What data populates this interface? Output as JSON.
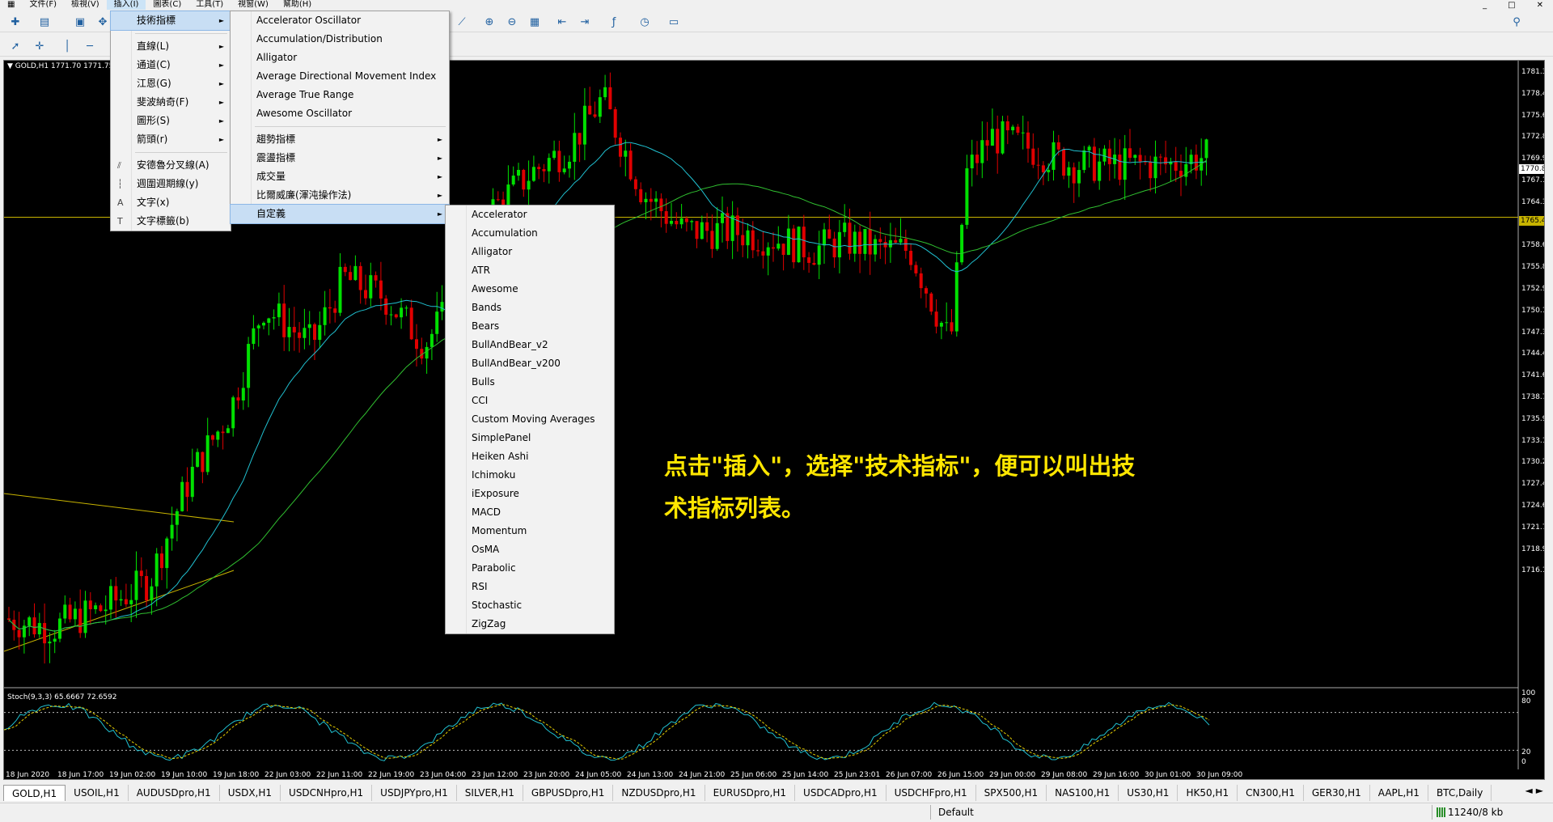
{
  "menubar": {
    "items": [
      "文件(F)",
      "檢視(V)",
      "插入(I)",
      "圖表(C)",
      "工具(T)",
      "視窗(W)",
      "幫助(H)"
    ],
    "active_index": 2,
    "win_buttons": [
      "_",
      "□",
      "✕"
    ]
  },
  "chart": {
    "symbol_label": "▼ GOLD,H1  1771.70 1771.75",
    "stoch_label": "Stoch(9,3,3) 65.6667 72.6592",
    "bid_price": "1770.83",
    "hline_price": "1765.43",
    "price_axis": [
      "1781.30",
      "1778.45",
      "1775.60",
      "1772.80",
      "1769.95",
      "1767.10",
      "1764.30",
      "1761.45",
      "1758.60",
      "1755.80",
      "1752.95",
      "1750.10",
      "1747.30",
      "1744.45",
      "1741.60",
      "1738.75",
      "1735.95",
      "1733.10",
      "1730.25",
      "1727.45",
      "1724.60",
      "1721.75",
      "1718.95",
      "1716.10"
    ],
    "stoch_axis": [
      "100",
      "80",
      "20",
      "0"
    ],
    "time_axis": [
      "18 Jun 2020",
      "18 Jun 17:00",
      "19 Jun 02:00",
      "19 Jun 10:00",
      "19 Jun 18:00",
      "22 Jun 03:00",
      "22 Jun 11:00",
      "22 Jun 19:00",
      "23 Jun 04:00",
      "23 Jun 12:00",
      "23 Jun 20:00",
      "24 Jun 05:00",
      "24 Jun 13:00",
      "24 Jun 21:00",
      "25 Jun 06:00",
      "25 Jun 14:00",
      "25 Jun 23:01",
      "26 Jun 07:00",
      "26 Jun 15:00",
      "29 Jun 00:00",
      "29 Jun 08:00",
      "29 Jun 16:00",
      "30 Jun 01:00",
      "30 Jun 09:00"
    ],
    "annotation_line1": "点击\"插入\"，选择\"技术指标\"，便可以叫出技",
    "annotation_line2": "术指标列表。",
    "colors": {
      "bull": "#00e000",
      "bear": "#e00000",
      "ma_fast": "#20c0d0",
      "ma_slow": "#30c030",
      "hline": "#c8b400",
      "annotation": "#ffe600"
    }
  },
  "insert_menu": {
    "items": [
      {
        "label": "技術指標",
        "icon": "",
        "submenu": true,
        "selected": true
      },
      {
        "sep": true
      },
      {
        "label": "直線(L)",
        "icon": "",
        "submenu": true
      },
      {
        "label": "通道(C)",
        "icon": "",
        "submenu": true
      },
      {
        "label": "江恩(G)",
        "icon": "",
        "submenu": true
      },
      {
        "label": "斐波納奇(F)",
        "icon": "",
        "submenu": true
      },
      {
        "label": "圖形(S)",
        "icon": "",
        "submenu": true
      },
      {
        "label": "箭頭(r)",
        "icon": "",
        "submenu": true
      },
      {
        "sep": true
      },
      {
        "label": "安德魯分叉線(A)",
        "icon": "⫽",
        "submenu": false
      },
      {
        "label": "週圍週期線(y)",
        "icon": "┆",
        "submenu": false
      },
      {
        "label": "文字(x)",
        "icon": "A",
        "submenu": false
      },
      {
        "label": "文字標籤(b)",
        "icon": "T",
        "submenu": false
      }
    ]
  },
  "indicators_menu": {
    "items": [
      {
        "label": "Accelerator Oscillator",
        "submenu": false
      },
      {
        "label": "Accumulation/Distribution",
        "submenu": false
      },
      {
        "label": "Alligator",
        "submenu": false
      },
      {
        "label": "Average Directional Movement Index",
        "submenu": false
      },
      {
        "label": "Average True Range",
        "submenu": false
      },
      {
        "label": "Awesome Oscillator",
        "submenu": false
      },
      {
        "sep": true
      },
      {
        "label": "趨勢指標",
        "submenu": true
      },
      {
        "label": "震盪指標",
        "submenu": true
      },
      {
        "label": "成交量",
        "submenu": true
      },
      {
        "label": "比爾威廉(渾沌操作法)",
        "submenu": true
      },
      {
        "label": "自定義",
        "submenu": true,
        "selected": true
      }
    ]
  },
  "custom_menu": {
    "items": [
      "Accelerator",
      "Accumulation",
      "Alligator",
      "ATR",
      "Awesome",
      "Bands",
      "Bears",
      "BullAndBear_v2",
      "BullAndBear_v200",
      "Bulls",
      "CCI",
      "Custom Moving Averages",
      "SimplePanel",
      "Heiken Ashi",
      "Ichimoku",
      "iExposure",
      "MACD",
      "Momentum",
      "OsMA",
      "Parabolic",
      "RSI",
      "Stochastic",
      "ZigZag"
    ]
  },
  "tabs": {
    "items": [
      "GOLD,H1",
      "USOIL,H1",
      "AUDUSDpro,H1",
      "USDX,H1",
      "USDCNHpro,H1",
      "USDJPYpro,H1",
      "SILVER,H1",
      "GBPUSDpro,H1",
      "NZDUSDpro,H1",
      "EURUSDpro,H1",
      "USDCADpro,H1",
      "USDCHFpro,H1",
      "SPX500,H1",
      "NAS100,H1",
      "US30,H1",
      "HK50,H1",
      "CN300,H1",
      "GER30,H1",
      "AAPL,H1",
      "BTC,Daily"
    ],
    "active_index": 0
  },
  "status": {
    "profile": "Default",
    "traffic": "11240/8 kb"
  }
}
